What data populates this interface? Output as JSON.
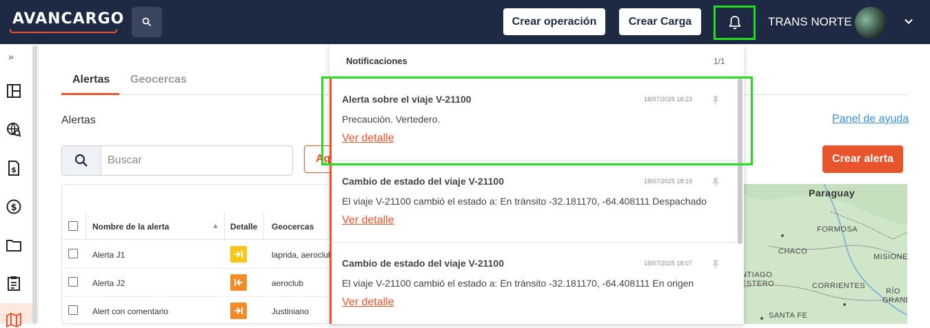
{
  "header": {
    "logo_text": "AVANCARGO",
    "create_operation_label": "Crear operación",
    "create_load_label": "Crear Carga",
    "user_name": "TRANS NORTE",
    "icons": [
      "search-icon",
      "bell-icon",
      "avatar",
      "chevron-down-icon"
    ]
  },
  "sidebar": {
    "expand_icon": "»",
    "items": [
      "dashboard-icon",
      "globe-search-icon",
      "document-dollar-icon",
      "dollar-circle-icon",
      "folder-icon",
      "clipboard-icon",
      "map-icon"
    ]
  },
  "tabs": [
    {
      "label": "Alertas",
      "active": true
    },
    {
      "label": "Geocercas",
      "active": false
    }
  ],
  "main": {
    "section_title": "Alertas",
    "help_link": "Panel de ayuda",
    "search_placeholder": "Buscar",
    "partial_button_label": "Ag",
    "create_alert_label": "Crear alerta"
  },
  "table": {
    "columns": [
      "Nombre de la alerta",
      "Detalle",
      "Geocercas"
    ],
    "sort_indicator": "▲",
    "rows": [
      {
        "name": "Alerta J1",
        "detail_color": "#f5c518",
        "geofences": "laprida, aeroclub"
      },
      {
        "name": "Alerta J2",
        "detail_color": "#f28c28",
        "geofences": "aeroclub"
      },
      {
        "name": "Alert con comentario",
        "detail_color": "#f28c28",
        "geofences": "Justiniano"
      }
    ]
  },
  "map": {
    "labels": [
      "Paraguay",
      "FORMOSA",
      "CHACO",
      "MISIONE",
      "NTIAGO",
      "ESTERO",
      "CORRIENTES",
      "RÍO",
      "GRANDE",
      "SANTA FE"
    ]
  },
  "notifications": {
    "title": "Notificaciones",
    "count": "1/1",
    "accent": "#e8542b",
    "items": [
      {
        "title": "Alerta sobre el viaje V-21100",
        "date": "18/07/2025 18:23",
        "body": "Precaución. Vertedero.",
        "link": "Ver detalle"
      },
      {
        "title": "Cambio de estado del viaje V-21100",
        "date": "18/07/2025 18:19",
        "body": "El viaje V-21100 cambió el estado a: En tránsito -32.181170, -64.408111 Despachado",
        "link": "Ver detalle"
      },
      {
        "title": "Cambio de estado del viaje V-21100",
        "date": "18/07/2025 18:07",
        "body": "El viaje V-21100 cambió el estado a: En tránsito -32.181170, -64.408111 En origen",
        "link": "Ver detalle"
      }
    ]
  },
  "highlight_color": "#22dd1e"
}
